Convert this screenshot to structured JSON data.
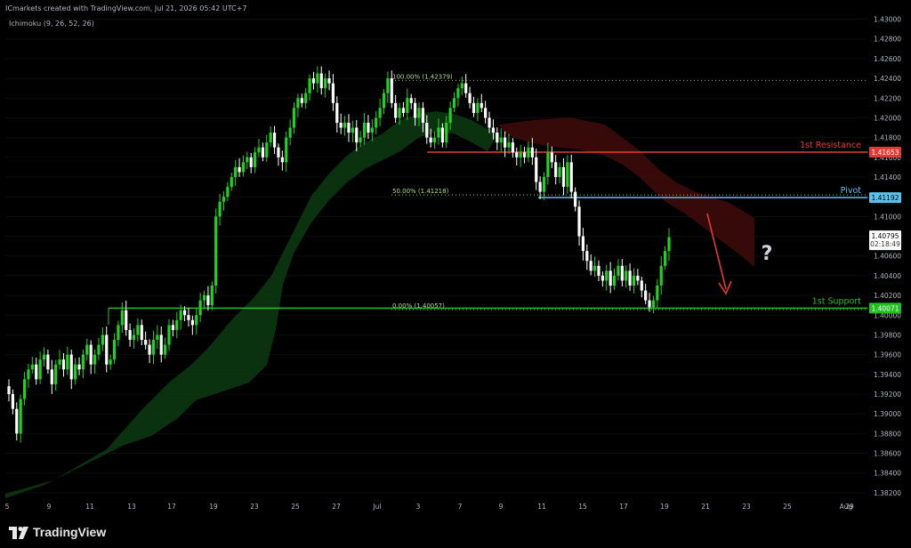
{
  "header": {
    "attribution": "ICmarkets created with TradingView.com, Jul 21, 2026 05:42 UTC+7",
    "indicator": "Ichimoku (9, 26, 52, 26)"
  },
  "footer": {
    "brand": "TradingView"
  },
  "colors": {
    "background": "#000000",
    "candle_up": "#1fd21f",
    "candle_down": "#ffffff",
    "resistance": "#e53935",
    "pivot": "#5bc0eb",
    "support": "#20c020",
    "fib": "#8bc34a",
    "cloud_bull": "#0d3b12",
    "cloud_bear": "#3d0b0b"
  },
  "chart_data": {
    "type": "candlestick",
    "symbol_indicator": "Ichimoku (9, 26, 52, 26)",
    "y_axis": {
      "range": [
        1.381,
        1.4305
      ],
      "ticks": [
        "1.43000",
        "1.42800",
        "1.42600",
        "1.42400",
        "1.42200",
        "1.42000",
        "1.41800",
        "1.41600",
        "1.41400",
        "1.41200",
        "1.41000",
        "1.40800",
        "1.40600",
        "1.40400",
        "1.40200",
        "1.40000",
        "1.39800",
        "1.39600",
        "1.39400",
        "1.39200",
        "1.39000",
        "1.38800",
        "1.38600",
        "1.38400",
        "1.38200"
      ]
    },
    "x_axis": {
      "ticks": [
        "5",
        "9",
        "11",
        "13",
        "17",
        "19",
        "23",
        "25",
        "27",
        "Jul",
        "3",
        "7",
        "9",
        "11",
        "15",
        "17",
        "19",
        "21",
        "23",
        "25",
        "29",
        "Aug"
      ]
    },
    "levels": [
      {
        "name": "1st Resistance",
        "price": 1.41653,
        "label": "1.41653"
      },
      {
        "name": "Pivot",
        "price": 1.41192,
        "label": "1.41192"
      },
      {
        "name": "1st Support",
        "price": 1.40071,
        "label": "1.40071"
      }
    ],
    "fibonacci": [
      {
        "label": "100.00% (1.42379)",
        "price": 1.42379
      },
      {
        "label": "50.00% (1.41218)",
        "price": 1.41218
      },
      {
        "label": "0.00% (1.40057)",
        "price": 1.40057
      }
    ],
    "current_price": {
      "value": "1.40795",
      "countdown": "02:18:49"
    },
    "annotation": "?",
    "closes": [
      1.392,
      1.3905,
      1.388,
      1.3915,
      1.3935,
      1.3945,
      1.395,
      1.3935,
      1.3955,
      1.396,
      1.3945,
      1.393,
      1.395,
      1.3955,
      1.3945,
      1.396,
      1.3935,
      1.395,
      1.3945,
      1.396,
      1.397,
      1.395,
      1.396,
      1.397,
      1.398,
      1.395,
      1.3955,
      1.3975,
      1.399,
      1.4005,
      1.3985,
      1.3975,
      1.398,
      1.399,
      1.3975,
      1.397,
      1.396,
      1.3975,
      1.398,
      1.396,
      1.397,
      1.399,
      1.3985,
      1.3995,
      1.4005,
      1.4,
      1.3995,
      1.399,
      1.4,
      1.4015,
      1.402,
      1.401,
      1.403,
      1.41,
      1.4115,
      1.412,
      1.413,
      1.414,
      1.415,
      1.4145,
      1.4155,
      1.416,
      1.415,
      1.4165,
      1.417,
      1.416,
      1.4175,
      1.4185,
      1.417,
      1.416,
      1.4155,
      1.418,
      1.419,
      1.421,
      1.422,
      1.4215,
      1.4225,
      1.424,
      1.4235,
      1.4245,
      1.423,
      1.424,
      1.4235,
      1.4215,
      1.4195,
      1.419,
      1.4195,
      1.4185,
      1.419,
      1.4175,
      1.418,
      1.4195,
      1.4185,
      1.419,
      1.42,
      1.421,
      1.4225,
      1.424,
      1.4215,
      1.42,
      1.421,
      1.4205,
      1.422,
      1.4215,
      1.42,
      1.421,
      1.4195,
      1.418,
      1.4175,
      1.418,
      1.419,
      1.4175,
      1.4195,
      1.421,
      1.422,
      1.423,
      1.4235,
      1.4225,
      1.4215,
      1.4205,
      1.4215,
      1.421,
      1.42,
      1.419,
      1.4185,
      1.4175,
      1.418,
      1.417,
      1.4175,
      1.4165,
      1.416,
      1.4165,
      1.416,
      1.417,
      1.416,
      1.4135,
      1.4125,
      1.414,
      1.4165,
      1.4155,
      1.414,
      1.415,
      1.413,
      1.4155,
      1.4125,
      1.411,
      1.408,
      1.4065,
      1.4055,
      1.4045,
      1.405,
      1.404,
      1.4035,
      1.4045,
      1.403,
      1.404,
      1.405,
      1.4035,
      1.4045,
      1.403,
      1.404,
      1.4035,
      1.4025,
      1.4015,
      1.4008,
      1.4015,
      1.403,
      1.405,
      1.4065,
      1.4079
    ]
  }
}
